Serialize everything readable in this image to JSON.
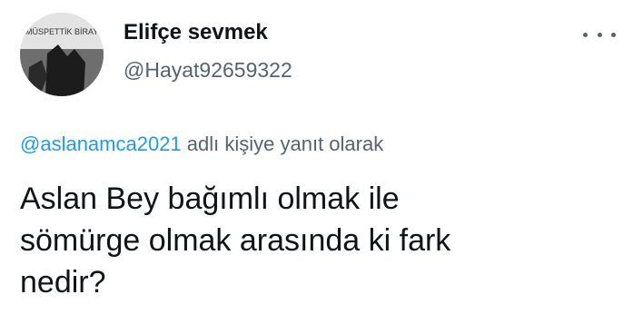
{
  "author": {
    "display_name": "Elifçe sevmek",
    "handle": "@Hayat92659322",
    "avatar_text": "MÜSPETTİK BİRAYIM"
  },
  "menu": {
    "icon": "more-horizontal-icon"
  },
  "reply": {
    "mention": "@aslanamca2021",
    "suffix": " adlı kişiye yanıt olarak"
  },
  "tweet": {
    "lines": [
      "Aslan Bey bağımlı olmak ile",
      "sömürge olmak arasında ki fark",
      "nedir?"
    ]
  },
  "colors": {
    "text": "#0f1419",
    "secondary": "#536471",
    "link": "#1d9bf0"
  }
}
